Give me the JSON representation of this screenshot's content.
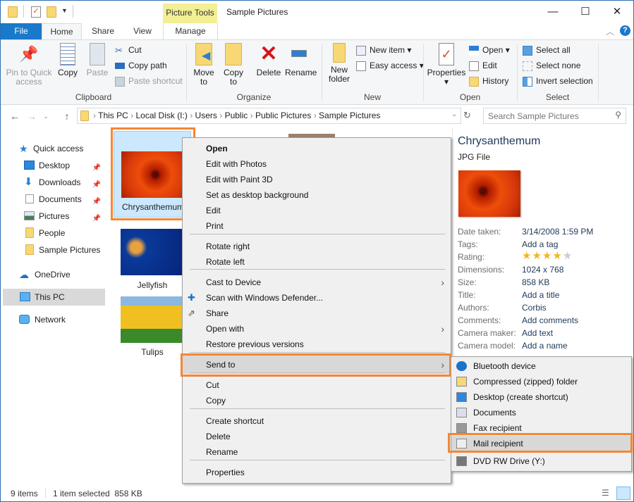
{
  "window": {
    "title": "Sample Pictures",
    "context_tab_group": "Picture Tools",
    "controls": {
      "minimize": "—",
      "maximize": "☐",
      "close": "✕"
    }
  },
  "tabs": [
    {
      "label": "File"
    },
    {
      "label": "Home"
    },
    {
      "label": "Share"
    },
    {
      "label": "View"
    },
    {
      "label": "Manage"
    }
  ],
  "ribbon": {
    "clipboard": {
      "label": "Clipboard",
      "pin": "Pin to Quick access",
      "copy": "Copy",
      "paste": "Paste",
      "cut": "Cut",
      "copy_path": "Copy path",
      "paste_shortcut": "Paste shortcut"
    },
    "organize": {
      "label": "Organize",
      "move_to": "Move to",
      "copy_to": "Copy to",
      "delete": "Delete",
      "rename": "Rename"
    },
    "new": {
      "label": "New",
      "new_folder": "New folder",
      "new_item": "New item",
      "easy_access": "Easy access"
    },
    "open": {
      "label": "Open",
      "properties": "Properties",
      "open": "Open",
      "edit": "Edit",
      "history": "History"
    },
    "select": {
      "label": "Select",
      "select_all": "Select all",
      "select_none": "Select none",
      "invert": "Invert selection"
    }
  },
  "address": {
    "crumbs": [
      "This PC",
      "Local Disk (I:)",
      "Users",
      "Public",
      "Public Pictures",
      "Sample Pictures"
    ],
    "search_placeholder": "Search Sample Pictures"
  },
  "sidebar": {
    "quick_access": "Quick access",
    "items": [
      {
        "label": "Desktop",
        "pinned": true
      },
      {
        "label": "Downloads",
        "pinned": true
      },
      {
        "label": "Documents",
        "pinned": true
      },
      {
        "label": "Pictures",
        "pinned": true
      },
      {
        "label": "People",
        "pinned": false
      },
      {
        "label": "Sample Pictures",
        "pinned": false
      }
    ],
    "onedrive": "OneDrive",
    "this_pc": "This PC",
    "network": "Network"
  },
  "files": [
    {
      "name": "Chrysanthemum",
      "selected": true
    },
    {
      "name": "Jellyfish",
      "selected": false
    },
    {
      "name": "Tulips",
      "selected": false
    }
  ],
  "context_menu": {
    "items": [
      {
        "label": "Open",
        "bold": true
      },
      {
        "label": "Edit with Photos"
      },
      {
        "label": "Edit with Paint 3D"
      },
      {
        "label": "Set as desktop background"
      },
      {
        "label": "Edit"
      },
      {
        "label": "Print"
      },
      {
        "label": "Rotate right"
      },
      {
        "label": "Rotate left"
      },
      {
        "label": "Cast to Device",
        "submenu": true
      },
      {
        "label": "Scan with Windows Defender..."
      },
      {
        "label": "Share"
      },
      {
        "label": "Open with",
        "submenu": true
      },
      {
        "label": "Restore previous versions"
      },
      {
        "label": "Send to",
        "submenu": true,
        "highlighted": true
      },
      {
        "label": "Cut"
      },
      {
        "label": "Copy"
      },
      {
        "label": "Create shortcut"
      },
      {
        "label": "Delete"
      },
      {
        "label": "Rename"
      },
      {
        "label": "Properties"
      }
    ]
  },
  "send_to_menu": {
    "items": [
      {
        "label": "Bluetooth device"
      },
      {
        "label": "Compressed (zipped) folder"
      },
      {
        "label": "Desktop (create shortcut)"
      },
      {
        "label": "Documents"
      },
      {
        "label": "Fax recipient"
      },
      {
        "label": "Mail recipient",
        "highlighted": true
      },
      {
        "label": "DVD RW Drive (Y:)"
      }
    ]
  },
  "preview": {
    "name": "Chrysanthemum",
    "type": "JPG File",
    "rating": 4,
    "rating_max": 5,
    "props": [
      {
        "k": "Date taken:",
        "v": "3/14/2008 1:59 PM"
      },
      {
        "k": "Tags:",
        "v": "Add a tag"
      },
      {
        "k": "Rating:",
        "v": ""
      },
      {
        "k": "Dimensions:",
        "v": "1024 x 768"
      },
      {
        "k": "Size:",
        "v": "858 KB"
      },
      {
        "k": "Title:",
        "v": "Add a title"
      },
      {
        "k": "Authors:",
        "v": "Corbis"
      },
      {
        "k": "Comments:",
        "v": "Add comments"
      },
      {
        "k": "Camera maker:",
        "v": "Add text"
      },
      {
        "k": "Camera model:",
        "v": "Add a name"
      }
    ]
  },
  "status": {
    "items": "9 items",
    "selected": "1 item selected  858 KB"
  },
  "colors": {
    "accent": "#1979ca",
    "highlight_outline": "#f58634",
    "picture_tools": "#f2ef94"
  }
}
